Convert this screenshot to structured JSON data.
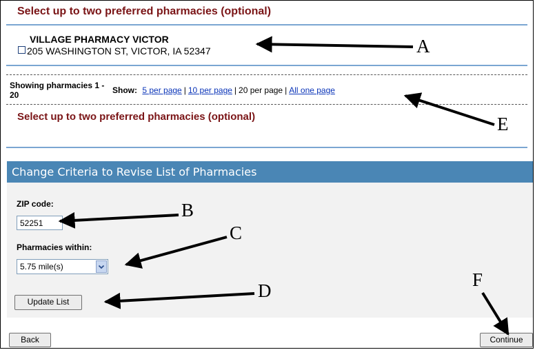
{
  "section1": {
    "title": "Select up to two preferred pharmacies (optional)",
    "pharmacy": {
      "name": "VILLAGE PHARMACY VICTOR",
      "address": "205 WASHINGTON ST, VICTOR, IA 52347"
    }
  },
  "paging": {
    "showing_label": "Showing pharmacies 1 - 20",
    "show_label": "Show:",
    "options": [
      "5 per page",
      "10 per page",
      "20 per page",
      "All one page"
    ],
    "separator": "|"
  },
  "section2": {
    "title": "Select up to two preferred pharmacies (optional)"
  },
  "criteria": {
    "header": "Change Criteria to Revise List of Pharmacies",
    "zip_label": "ZIP code:",
    "zip_value": "52251",
    "within_label": "Pharmacies within:",
    "within_value": "5.75 mile(s)",
    "update_button": "Update List"
  },
  "footer": {
    "back_button": "Back",
    "continue_button": "Continue"
  },
  "annotations": [
    "A",
    "B",
    "C",
    "D",
    "E",
    "F"
  ],
  "colors": {
    "section_title": "#7a1416",
    "panel_header": "#4a86b5",
    "link": "#0a34b8"
  }
}
